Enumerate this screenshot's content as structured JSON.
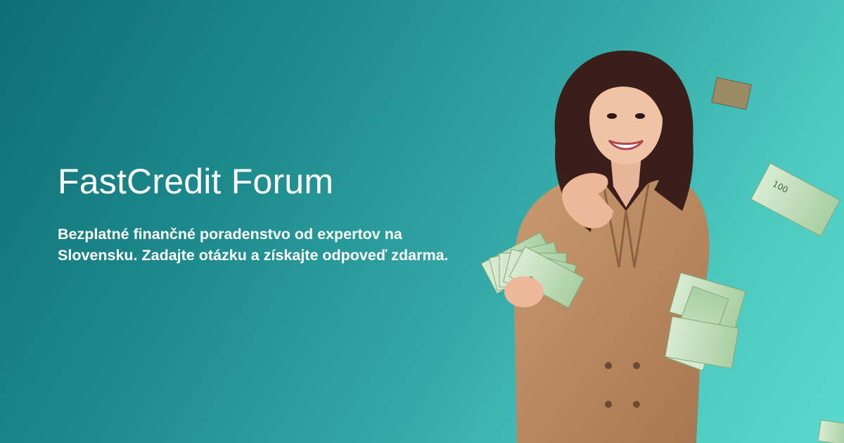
{
  "banner": {
    "title": "FastCredit Forum",
    "description": "Bezplatné finančné poradenstvo od expertov na Slovensku. Zadajte otázku a získajte odpoveď zdarma.",
    "colors": {
      "gradient_start": "#0f6e75",
      "gradient_end": "#5ad9cf",
      "text": "#ffffff",
      "jacket": "#b8865e",
      "banknote": "#cfe3c8"
    },
    "illustration": {
      "subject": "smiling woman in camel blazer holding euro banknotes",
      "items": [
        "woman-figure",
        "banknote-fan",
        "falling-banknotes"
      ]
    }
  }
}
